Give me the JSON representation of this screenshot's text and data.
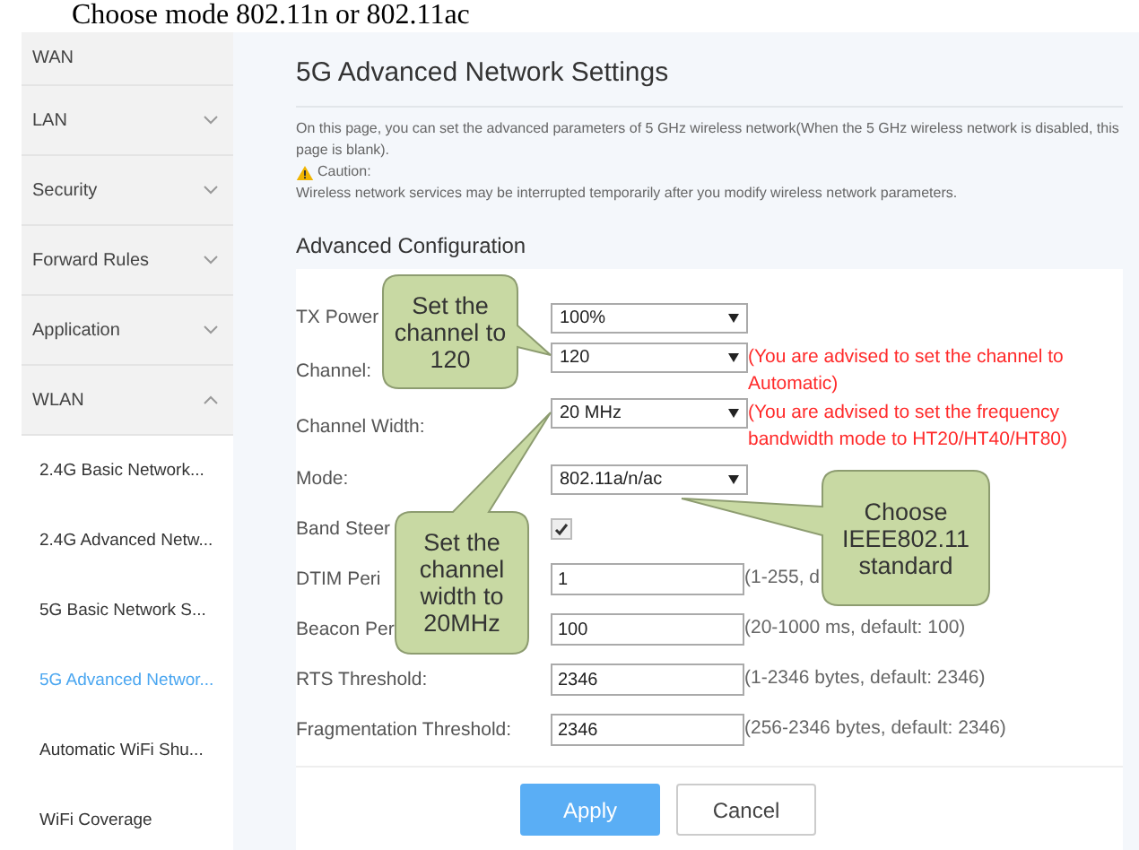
{
  "caption": "Choose mode 802.11n or 802.11ac",
  "sidebar": {
    "items": [
      {
        "label": "WAN",
        "kind": "plain"
      },
      {
        "label": "LAN",
        "kind": "group",
        "expanded": false
      },
      {
        "label": "Security",
        "kind": "group",
        "expanded": false
      },
      {
        "label": "Forward Rules",
        "kind": "group",
        "expanded": false
      },
      {
        "label": "Application",
        "kind": "group",
        "expanded": false
      },
      {
        "label": "WLAN",
        "kind": "group",
        "expanded": true,
        "children": [
          {
            "label": "2.4G Basic Network...",
            "selected": false
          },
          {
            "label": "2.4G Advanced Netw...",
            "selected": false
          },
          {
            "label": "5G Basic Network S...",
            "selected": false
          },
          {
            "label": "5G Advanced Networ...",
            "selected": true
          },
          {
            "label": "Automatic WiFi Shu...",
            "selected": false
          },
          {
            "label": "WiFi Coverage",
            "selected": false
          }
        ]
      }
    ]
  },
  "page": {
    "title": "5G Advanced Network Settings",
    "intro": "On this page, you can set the advanced parameters of 5 GHz wireless network(When the 5 GHz wireless network is disabled, this page is blank).",
    "caution_label": "Caution:",
    "caution": "Wireless network services may be interrupted temporarily after you modify wireless network parameters.",
    "section": "Advanced Configuration",
    "fields": [
      {
        "label": "TX Power",
        "kind": "select",
        "value": "100%"
      },
      {
        "label": "Channel:",
        "kind": "select",
        "value": "120",
        "hint": {
          "text": "(You are advised to set the channel to Automatic)",
          "warning": true
        }
      },
      {
        "label": "Channel Width:",
        "kind": "select",
        "value": "20 MHz",
        "hint": {
          "text": "(You are advised to set the frequency bandwidth mode to HT20/HT40/HT80)",
          "warning": true
        }
      },
      {
        "label": "Mode:",
        "kind": "select",
        "value": "802.11a/n/ac"
      },
      {
        "label": "Band Steer",
        "kind": "checkbox",
        "checked": true
      },
      {
        "label": "DTIM Peri",
        "kind": "text",
        "value": "1",
        "hint": {
          "text": "(1-255, d",
          "warning": false
        }
      },
      {
        "label": "Beacon Per",
        "kind": "text",
        "value": "100",
        "hint": {
          "text": "(20-1000 ms, default: 100)",
          "warning": false
        }
      },
      {
        "label": "RTS Threshold:",
        "kind": "text",
        "value": "2346",
        "hint": {
          "text": "(1-2346 bytes, default: 2346)",
          "warning": false
        }
      },
      {
        "label": "Fragmentation Threshold:",
        "kind": "text",
        "value": "2346",
        "hint": {
          "text": "(256-2346 bytes, default: 2346)",
          "warning": false
        }
      }
    ],
    "buttons": [
      {
        "label": "Apply",
        "kind": "primary"
      },
      {
        "label": "Cancel",
        "kind": "secondary"
      }
    ]
  },
  "callouts": [
    {
      "text": "Set the channel to 120"
    },
    {
      "text": "Set the channel width to 20MHz"
    },
    {
      "text": "Choose IEEE802.11 standard"
    }
  ]
}
